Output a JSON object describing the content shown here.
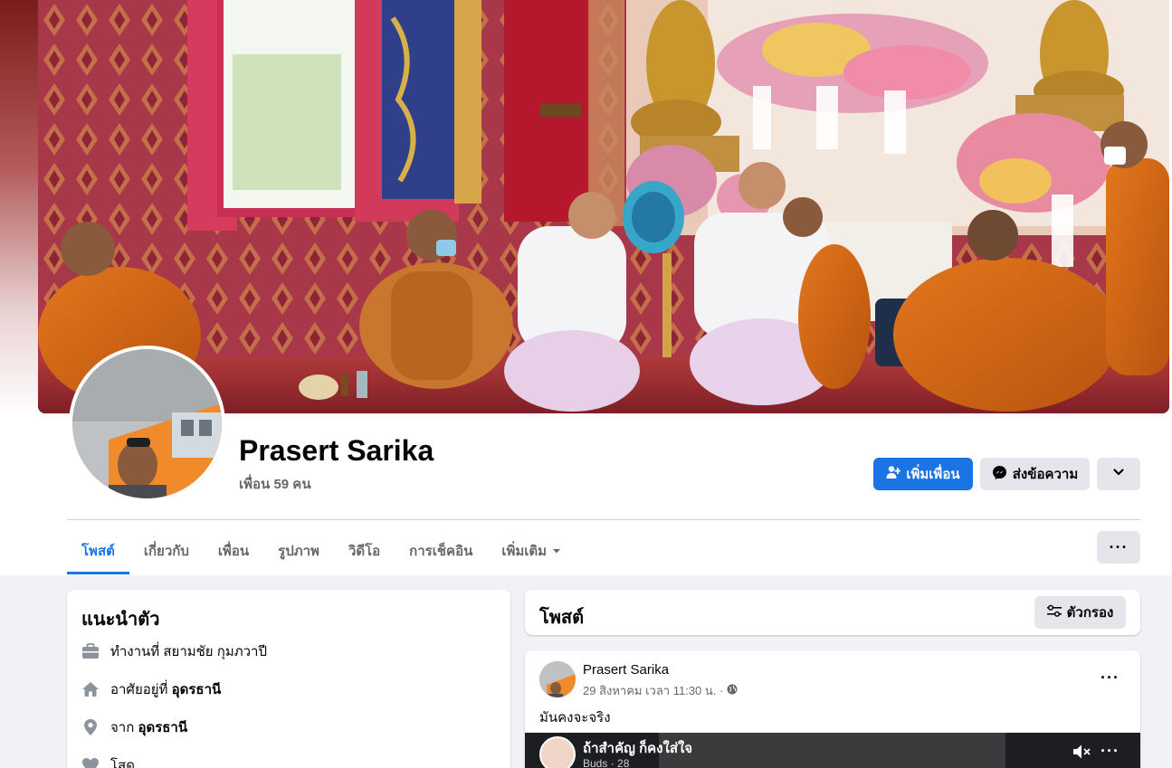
{
  "profile": {
    "name": "Prasert Sarika",
    "friends": "เพื่อน 59 คน"
  },
  "actions": {
    "add_friend": "เพิ่มเพื่อน",
    "message": "ส่งข้อความ"
  },
  "tabs": [
    {
      "label": "โพสต์",
      "active": true
    },
    {
      "label": "เกี่ยวกับ"
    },
    {
      "label": "เพื่อน"
    },
    {
      "label": "รูปภาพ"
    },
    {
      "label": "วิดีโอ"
    },
    {
      "label": "การเช็คอิน"
    },
    {
      "label": "เพิ่มเติม"
    }
  ],
  "intro": {
    "title": "แนะนำตัว",
    "work_prefix": "ทำงานที่ ",
    "work_place": "สยามชัย กุมภวาปี",
    "lives_prefix": "อาศัยอยู่ที่ ",
    "lives_place": "อุดรธานี",
    "from_prefix": "จาก ",
    "from_place": "อุดรธานี",
    "relationship": "โสด"
  },
  "posts_header": {
    "title": "โพสต์",
    "filter_label": "ตัวกรอง"
  },
  "post": {
    "author": "Prasert Sarika",
    "time": "29 สิงหาคม เวลา 11:30 น. ·",
    "text": "มันคงจะจริง",
    "video_title": "ถ้าสำคัญ ก็คงใส่ใจ",
    "video_sub": "Buds · 28"
  },
  "colors": {
    "accent": "#1b74e4",
    "secondary_text": "#65676b",
    "button_gray": "#e4e6eb",
    "page_bg": "#f0f2f5"
  },
  "icons": {
    "add_friend": "person-plus-icon",
    "message": "messenger-icon",
    "more": "chevron-down-icon",
    "filter": "sliders-icon",
    "work": "briefcase-icon",
    "home": "home-icon",
    "from": "location-pin-icon",
    "relationship": "heart-icon",
    "privacy": "globe-icon",
    "mute": "speaker-mute-icon"
  }
}
